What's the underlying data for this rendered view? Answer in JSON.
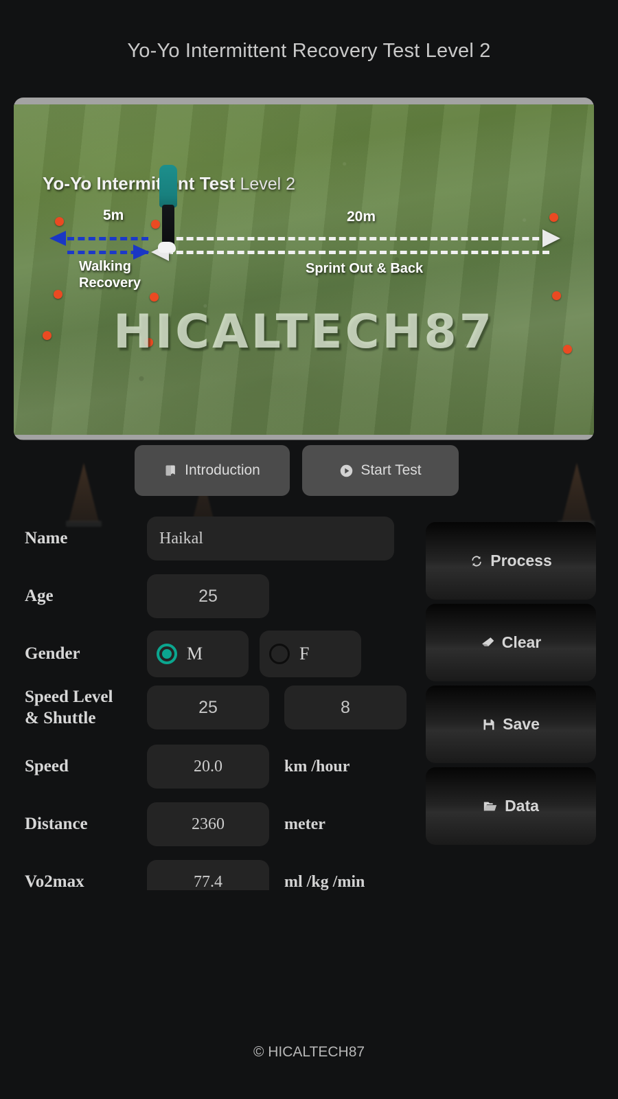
{
  "header": {
    "title": "Yo-Yo Intermittent Recovery Test Level 2"
  },
  "media": {
    "diagram_title": "Yo-Yo Intermittent Test",
    "diagram_level": "Level 2",
    "label_5m": "5m",
    "label_20m": "20m",
    "label_walking": "Walking",
    "label_recovery": "Recovery",
    "label_sprint": "Sprint Out & Back",
    "watermark": "HICALTECH87"
  },
  "tabs": [
    {
      "label": "Introduction",
      "icon": "book-icon"
    },
    {
      "label": "Start Test",
      "icon": "play-circle-icon"
    }
  ],
  "form": {
    "name": {
      "label": "Name",
      "value": "Haikal"
    },
    "age": {
      "label": "Age",
      "value": "25"
    },
    "gender": {
      "label": "Gender",
      "options": [
        {
          "value": "M",
          "selected": true
        },
        {
          "value": "F",
          "selected": false
        }
      ]
    },
    "speed_level_shuttle": {
      "label_line1": "Speed Level",
      "label_line2": "& Shuttle",
      "level": "25",
      "shuttle": "8"
    },
    "speed": {
      "label": "Speed",
      "value": "20.0",
      "unit": "km /hour"
    },
    "distance": {
      "label": "Distance",
      "value": "2360",
      "unit": "meter"
    },
    "vo2max": {
      "label": "Vo2max",
      "value": "77.4",
      "unit": "ml /kg /min"
    }
  },
  "actions": [
    {
      "label": "Process",
      "icon": "refresh-icon"
    },
    {
      "label": "Clear",
      "icon": "eraser-icon"
    },
    {
      "label": "Save",
      "icon": "floppy-disk-icon"
    },
    {
      "label": "Data",
      "icon": "folder-open-icon"
    }
  ],
  "footer": {
    "text": "© HICALTECH87"
  },
  "colors": {
    "background": "#111213",
    "accent_teal": "#0ba68f",
    "frame_border": "#a3a3a3",
    "turf_green": "#62803f",
    "cone_orange": "#ea4a22",
    "arrow_blue": "#1a37c4"
  }
}
